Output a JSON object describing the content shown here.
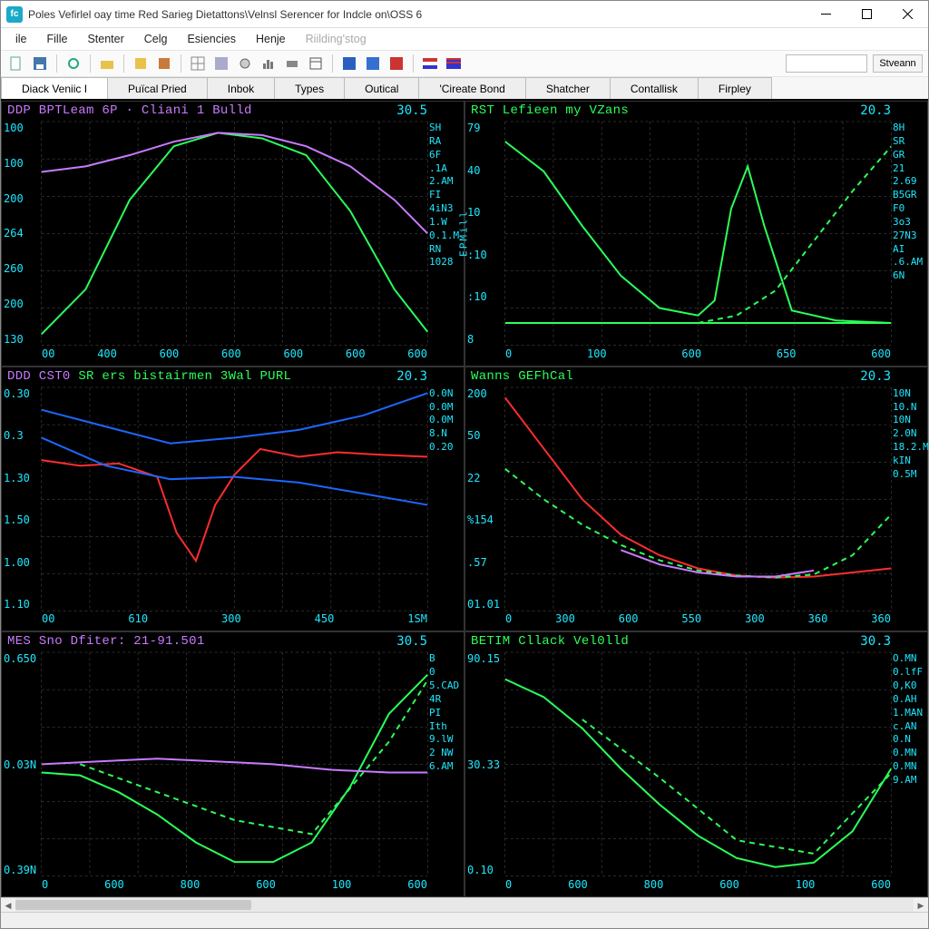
{
  "window": {
    "title": "Poles Vefirlel oay time  Red Sarieg Dietattons\\Velnsl Serencer for Indcle on\\OSS 6",
    "app_icon_letter": "fc"
  },
  "menu": [
    "ile",
    "Fille",
    "Stenter",
    "Celg",
    "Esiencies",
    "Henje"
  ],
  "menu_disabled": [
    "Riilding'stog"
  ],
  "toolbar_search_button": "Stveann",
  "tabs": [
    "Diack Veniic I",
    "Puïcal Pried",
    "Inbok",
    "Types",
    "Outical",
    "'Cireate Bond",
    "Shatcher",
    "Contallisk",
    "Firpley"
  ],
  "active_tab_index": 0,
  "panes": [
    {
      "title": "DDP BPTLeam 6P · Cliani 1 Bulld",
      "title_color": "#c97aff",
      "value": "30.5",
      "yticks": [
        "100",
        "100",
        "200",
        "264",
        "260",
        "200",
        "130"
      ],
      "xticks": [
        "00",
        "400",
        "600",
        "600",
        "600",
        "600",
        "600"
      ],
      "tags": [
        "SH",
        "RA",
        "6F",
        ".1A",
        "2.AM",
        "FI",
        "4iN3",
        "1.W",
        "0.1.M",
        "RN",
        "1028"
      ]
    },
    {
      "title": "RST Lefieen my VZans",
      "title_color": "#2bff5a",
      "value": "20.3",
      "yticks": [
        "79",
        "40",
        "10",
        ":10",
        ":10",
        "8"
      ],
      "xticks": [
        "0",
        "100",
        "600",
        "650",
        "600"
      ],
      "tags": [
        "8H",
        "SR",
        "GR",
        "21",
        "2.69",
        "B5GR",
        "F0",
        "3o3",
        "27N3",
        "AI",
        ".6.AM",
        "6N"
      ],
      "ylabel": "EPMill"
    },
    {
      "title": "DDD CST0 SR ers bistairmen 3Wal PURL",
      "title_color_a": "#c97aff",
      "title_color_b": "#2bff5a",
      "value": "20.3",
      "yticks": [
        "0.30",
        "0.3",
        "1.30",
        "1.50",
        "1.00",
        "1.10"
      ],
      "xticks": [
        "00",
        "610",
        "300",
        "450",
        "1SM"
      ],
      "tags": [
        "0.0N",
        "0.0M",
        "0.0M",
        "8.N",
        "0.20"
      ]
    },
    {
      "title": "Wanns GEFhCal",
      "title_color": "#2bff5a",
      "value": "20.3",
      "yticks": [
        "200",
        "50",
        "22",
        "%154",
        ".57",
        "01.01"
      ],
      "xticks": [
        "0",
        "300",
        "600",
        "550",
        "300",
        "360",
        "360"
      ],
      "tags": [
        "10N",
        "10.N",
        "10N",
        "2.0N",
        "18.2.M",
        "kIN",
        "0.5M"
      ]
    },
    {
      "title": "MES Sno Dfiter: 21-91.501",
      "title_color": "#c97aff",
      "value": "30.5",
      "yticks": [
        "0.650",
        "0.03N",
        "0.39N"
      ],
      "xticks": [
        "0",
        "600",
        "800",
        "600",
        "100",
        "600"
      ],
      "tags": [
        "B",
        "0",
        "5.CAD",
        "4R",
        "PI",
        "Ith",
        "9.lW",
        "2 NW",
        "6.AM"
      ]
    },
    {
      "title": "BETIM Cllack Vel0lld",
      "title_color": "#2bff5a",
      "value": "30.3",
      "yticks": [
        "90.15",
        "30.33",
        "0.10"
      ],
      "xticks": [
        "0",
        "600",
        "800",
        "600",
        "100",
        "600"
      ],
      "tags": [
        "O.MN",
        "0.lfF",
        "0,K0",
        "0.AH",
        "1.MAN",
        "c.AN",
        "0.N",
        "0.MN",
        "0.MN",
        "9.AM"
      ]
    }
  ],
  "chart_data": [
    {
      "type": "line",
      "title": "DDP BPTLeam 6P · Cliani 1 Bulld",
      "xlabel": "",
      "ylabel": "",
      "xlim": [
        0,
        700
      ],
      "ylim": [
        100,
        300
      ],
      "series": [
        {
          "name": "green",
          "color": "#2bff5a",
          "x": [
            0,
            80,
            160,
            240,
            320,
            400,
            480,
            560,
            640,
            700
          ],
          "y": [
            110,
            150,
            230,
            278,
            290,
            285,
            270,
            220,
            150,
            112
          ]
        },
        {
          "name": "purple",
          "color": "#c97aff",
          "x": [
            0,
            80,
            160,
            240,
            320,
            400,
            480,
            560,
            640,
            700
          ],
          "y": [
            255,
            260,
            270,
            282,
            290,
            288,
            278,
            260,
            230,
            200
          ]
        }
      ]
    },
    {
      "type": "line",
      "title": "RST Lefieen my VZans",
      "xlabel": "",
      "ylabel": "EPMill",
      "xlim": [
        0,
        700
      ],
      "ylim": [
        0,
        90
      ],
      "series": [
        {
          "name": "green-main",
          "color": "#2bff5a",
          "x": [
            0,
            70,
            140,
            210,
            280,
            350,
            380,
            410,
            440,
            470,
            520,
            600,
            700
          ],
          "y": [
            82,
            70,
            48,
            28,
            15,
            12,
            18,
            55,
            72,
            48,
            14,
            10,
            9
          ]
        },
        {
          "name": "green-rise",
          "color": "#2bff5a",
          "style": "dash",
          "x": [
            350,
            420,
            490,
            560,
            630,
            700
          ],
          "y": [
            9,
            12,
            22,
            42,
            62,
            80
          ]
        },
        {
          "name": "green-base",
          "color": "#2bff5a",
          "x": [
            0,
            700
          ],
          "y": [
            9,
            9
          ]
        }
      ]
    },
    {
      "type": "line",
      "title": "DDD CST0 SR ers bistairmen 3Wal PURL",
      "xlabel": "",
      "ylabel": "",
      "xlim": [
        0,
        600
      ],
      "ylim": [
        0,
        2
      ],
      "series": [
        {
          "name": "red",
          "color": "#ff2d2d",
          "x": [
            0,
            60,
            120,
            180,
            210,
            240,
            270,
            300,
            340,
            400,
            460,
            520,
            600
          ],
          "y": [
            1.35,
            1.3,
            1.32,
            1.2,
            0.7,
            0.45,
            0.95,
            1.22,
            1.45,
            1.38,
            1.42,
            1.4,
            1.38
          ]
        },
        {
          "name": "blue-upper",
          "color": "#1e66ff",
          "x": [
            0,
            100,
            200,
            300,
            400,
            500,
            600
          ],
          "y": [
            1.55,
            1.3,
            1.18,
            1.2,
            1.15,
            1.05,
            0.95
          ]
        },
        {
          "name": "blue-lower",
          "color": "#1e66ff",
          "x": [
            0,
            100,
            200,
            300,
            400,
            500,
            600
          ],
          "y": [
            1.8,
            1.65,
            1.5,
            1.55,
            1.62,
            1.75,
            1.95
          ]
        }
      ]
    },
    {
      "type": "line",
      "title": "Wanns GEFhCal",
      "xlabel": "",
      "ylabel": "",
      "xlim": [
        0,
        700
      ],
      "ylim": [
        0,
        220
      ],
      "series": [
        {
          "name": "red",
          "color": "#ff2d2d",
          "x": [
            0,
            70,
            140,
            210,
            280,
            350,
            420,
            490,
            560,
            630,
            700
          ],
          "y": [
            210,
            160,
            110,
            75,
            55,
            42,
            35,
            33,
            34,
            38,
            42
          ]
        },
        {
          "name": "green",
          "color": "#2bff5a",
          "style": "dash",
          "x": [
            0,
            70,
            140,
            210,
            280,
            350,
            420,
            490,
            560,
            630,
            700
          ],
          "y": [
            140,
            110,
            85,
            65,
            50,
            40,
            35,
            33,
            36,
            55,
            95
          ]
        },
        {
          "name": "purple",
          "color": "#c97aff",
          "x": [
            210,
            280,
            350,
            420,
            490,
            560
          ],
          "y": [
            60,
            46,
            38,
            34,
            34,
            40
          ]
        }
      ]
    },
    {
      "type": "line",
      "title": "MES Sno Dfiter: 21-91.501",
      "xlabel": "",
      "ylabel": "",
      "xlim": [
        0,
        800
      ],
      "ylim": [
        0,
        0.8
      ],
      "series": [
        {
          "name": "green",
          "color": "#2bff5a",
          "x": [
            0,
            80,
            160,
            240,
            320,
            400,
            480,
            560,
            640,
            720,
            800
          ],
          "y": [
            0.37,
            0.36,
            0.3,
            0.22,
            0.12,
            0.05,
            0.05,
            0.12,
            0.32,
            0.58,
            0.72
          ]
        },
        {
          "name": "green-dash",
          "color": "#2bff5a",
          "style": "dash",
          "x": [
            80,
            240,
            400,
            560,
            720,
            800
          ],
          "y": [
            0.4,
            0.3,
            0.2,
            0.15,
            0.48,
            0.7
          ]
        },
        {
          "name": "purple",
          "color": "#c97aff",
          "x": [
            0,
            120,
            240,
            360,
            480,
            600,
            720,
            800
          ],
          "y": [
            0.4,
            0.41,
            0.42,
            0.41,
            0.4,
            0.38,
            0.37,
            0.37
          ]
        }
      ]
    },
    {
      "type": "line",
      "title": "BETIM Cllack Vel0lld",
      "xlabel": "",
      "ylabel": "",
      "xlim": [
        0,
        800
      ],
      "ylim": [
        0,
        100
      ],
      "series": [
        {
          "name": "green",
          "color": "#2bff5a",
          "x": [
            0,
            80,
            160,
            240,
            320,
            400,
            480,
            560,
            640,
            720,
            800
          ],
          "y": [
            88,
            80,
            66,
            48,
            32,
            18,
            8,
            4,
            6,
            20,
            48
          ]
        },
        {
          "name": "green-dash",
          "color": "#2bff5a",
          "style": "dash",
          "x": [
            160,
            320,
            480,
            640,
            800
          ],
          "y": [
            70,
            44,
            16,
            10,
            46
          ]
        }
      ]
    }
  ]
}
